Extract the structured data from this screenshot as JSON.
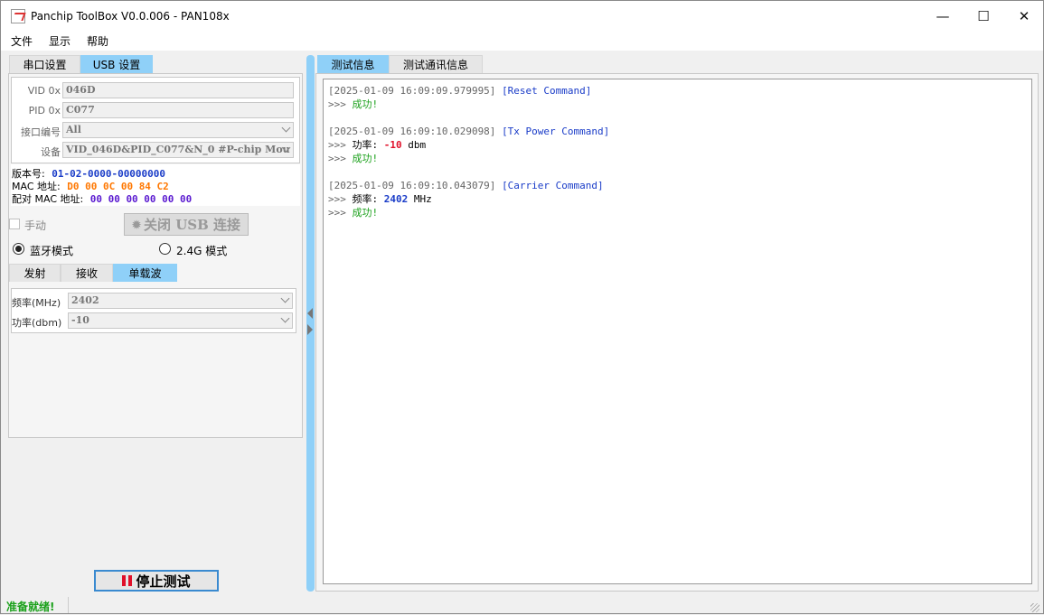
{
  "window": {
    "title": "Panchip ToolBox V0.0.006 - PAN108x",
    "minimize": "—",
    "maximize": "☐",
    "close": "✕"
  },
  "menu": [
    "文件",
    "显示",
    "帮助"
  ],
  "left_tabs": [
    {
      "label": "串口设置",
      "active": false
    },
    {
      "label": "USB 设置",
      "active": true
    }
  ],
  "usb": {
    "vid_label": "VID 0x",
    "vid_value": "046D",
    "pid_label": "PID 0x",
    "pid_value": "C077",
    "port_label": "接口编号",
    "port_value": "All",
    "device_label": "设备",
    "device_value": "VID_046D&PID_C077&N_0 #P-chip Mou"
  },
  "device_info": {
    "version_label": "版本号:",
    "version_value": "01-02-0000-00000000",
    "mac_label": "MAC 地址:",
    "mac_value": "D0 00 0C 00 84 C2",
    "pair_mac_label": "配对 MAC 地址:",
    "pair_mac_value": "00 00 00 00 00 00",
    "colors": {
      "version": "#1a3cc8",
      "mac": "#ff7700",
      "pair_mac": "#5a1ad0"
    }
  },
  "manual_label": "手动",
  "close_usb_button": "关闭 USB 连接",
  "mode": {
    "bluetooth_label": "蓝牙模式",
    "g24_label": "2.4G 模式",
    "selected": "bluetooth"
  },
  "sub_tabs": [
    {
      "label": "发射",
      "active": false
    },
    {
      "label": "接收",
      "active": false
    },
    {
      "label": "单载波",
      "active": true
    }
  ],
  "carrier": {
    "freq_label": "频率(MHz)",
    "freq_value": "2402",
    "power_label": "功率(dbm)",
    "power_value": "-10"
  },
  "stop_button": "停止测试",
  "right_tabs": [
    {
      "label": "测试信息",
      "active": true
    },
    {
      "label": "测试通讯信息",
      "active": false
    }
  ],
  "log": [
    {
      "timestamp": "[2025-01-09 16:09:09.979995]",
      "command": "[Reset Command]",
      "lines": [
        {
          "prompt": ">>>",
          "text": "成功!",
          "kind": "ok"
        }
      ]
    },
    {
      "timestamp": "[2025-01-09 16:09:10.029098]",
      "command": "[Tx Power Command]",
      "lines": [
        {
          "prompt": ">>>",
          "label": "功率:",
          "value": "-10",
          "unit": "dbm",
          "kind": "value-red"
        },
        {
          "prompt": ">>>",
          "text": "成功!",
          "kind": "ok"
        }
      ]
    },
    {
      "timestamp": "[2025-01-09 16:09:10.043079]",
      "command": "[Carrier Command]",
      "lines": [
        {
          "prompt": ">>>",
          "label": "频率:",
          "value": "2402",
          "unit": "MHz",
          "kind": "value-blue"
        },
        {
          "prompt": ">>>",
          "text": "成功!",
          "kind": "ok"
        }
      ]
    }
  ],
  "status": "准备就绪!"
}
